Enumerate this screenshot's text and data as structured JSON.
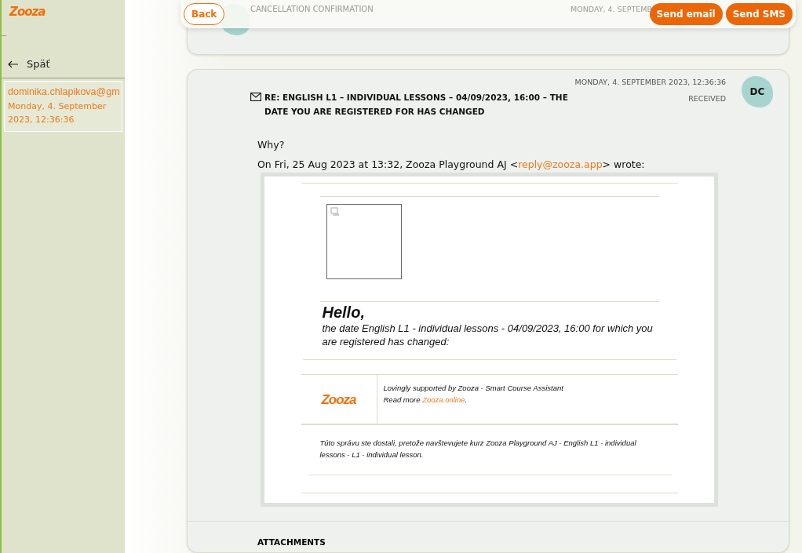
{
  "sidebar": {
    "logo": "Zooza",
    "back_label": "Späť",
    "messages": [
      {
        "sender": "dominika.chlapikova@gm",
        "date": "Monday, 4. September 2023, 12:36:36",
        "selected": true
      }
    ]
  },
  "toolbar": {
    "buttons": [
      {
        "label": "Back",
        "kind": "outline"
      },
      {
        "label": "Send email",
        "kind": "filled"
      },
      {
        "label": "Send SMS",
        "kind": "filled"
      }
    ]
  },
  "previous_message": {
    "subject": "CANCELLATION CONFIRMATION",
    "date": "MONDAY, 4. SEPTEMB"
  },
  "message": {
    "date": "MONDAY, 4. SEPTEMBER 2023, 12:36:36",
    "status": "RECEIVED",
    "avatar": "DC",
    "subject": "RE: ENGLISH L1 – INDIVIDUAL LESSONS – 04/09/2023, 16:00 – THE DATE YOU ARE REGISTERED FOR HAS CHANGED",
    "body": "Why?",
    "quote_before": "On Fri, 25 Aug 2023 at 13:32, Zooza Playground AJ <",
    "quote_link": "reply@zooza.app",
    "quote_after": "> wrote:",
    "email": {
      "greeting": "Hello,",
      "text": "the date English L1 - individual lessons - 04/09/2023, 16:00 for which you are registered has changed:",
      "footer_logo": "Zooza",
      "support_line": "Lovingly supported by Zooza - Smart Course Assistant",
      "read_more": "Read more ",
      "read_more_link": "Zooza.online",
      "read_more_end": ".",
      "notice": "Túto správu ste dostali, pretože navštevujete kurz Zooza Playground AJ - English L1 - individual lessons - L1 - individual lesson."
    }
  },
  "attachments_title": "ATTACHMENTS"
}
